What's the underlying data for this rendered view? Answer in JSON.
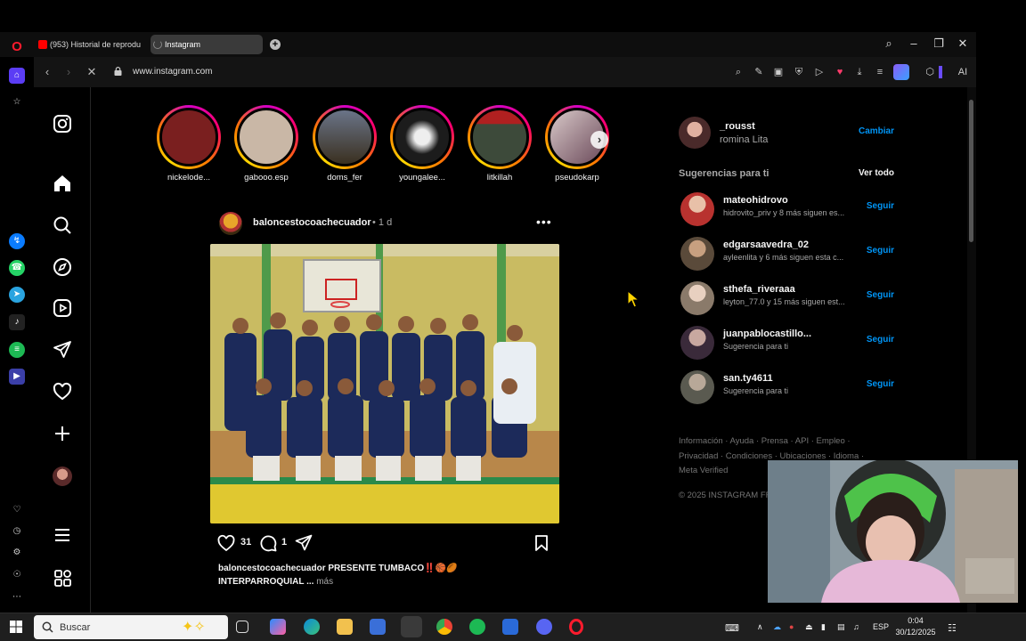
{
  "browser": {
    "tabs": [
      {
        "label": "(953) Historial de reprodu"
      },
      {
        "label": "Instagram"
      }
    ],
    "url": "www.instagram.com"
  },
  "stories": [
    {
      "username": "nickelode...",
      "color": "#7a1f1f"
    },
    {
      "username": "gabooo.esp",
      "color": "#c9b7a6"
    },
    {
      "username": "doms_fer",
      "color": "#4a5260"
    },
    {
      "username": "youngalee...",
      "color": "#1c1c1c"
    },
    {
      "username": "litkillah",
      "color": "#3d4a3a"
    },
    {
      "username": "pseudokarp",
      "color": "#6b4a5a"
    }
  ],
  "post": {
    "username": "baloncestocoachecuador",
    "time": "1 d",
    "likes": "31",
    "comments": "1",
    "caption_line1": "baloncestocoachecuador PRESENTE TUMBACO‼️🏀🏉",
    "caption_line2": "INTERPARROQUIAL ...",
    "more_label": "más"
  },
  "me": {
    "username": "_rousst",
    "name": "romina Lita",
    "switch_label": "Cambiar"
  },
  "suggestions": {
    "title": "Sugerencias para ti",
    "see_all": "Ver todo",
    "follow_label": "Seguir",
    "items": [
      {
        "username": "mateohidrovo",
        "subtitle": "hidrovito_priv y 8 más siguen es...",
        "color": "#b8322f"
      },
      {
        "username": "edgarsaavedra_02",
        "subtitle": "ayleenlita y 6 más siguen esta c...",
        "color": "#8a6a4a"
      },
      {
        "username": "sthefa_riveraaa",
        "subtitle": "leyton_77.0 y 15 más siguen est...",
        "color": "#c8b09a"
      },
      {
        "username": "juanpablocastillo...",
        "subtitle": "Sugerencia para ti",
        "color": "#6a5060"
      },
      {
        "username": "san.ty4611",
        "subtitle": "Sugerencia para ti",
        "color": "#9a9080"
      }
    ]
  },
  "footer": {
    "links_line1": "Información · Ayuda · Prensa · API · Empleo ·",
    "links_line2": "Privacidad · Condiciones · Ubicaciones · Idioma ·",
    "links_line3": "Meta Verified",
    "copyright": "© 2025 INSTAGRAM FROM META"
  },
  "taskbar": {
    "search_placeholder": "Buscar",
    "language": "ESP",
    "time": "0:04",
    "date": "30/12/2025"
  },
  "colors": {
    "accent_blue": "#0095f6",
    "opera_red": "#ff1b2d"
  }
}
